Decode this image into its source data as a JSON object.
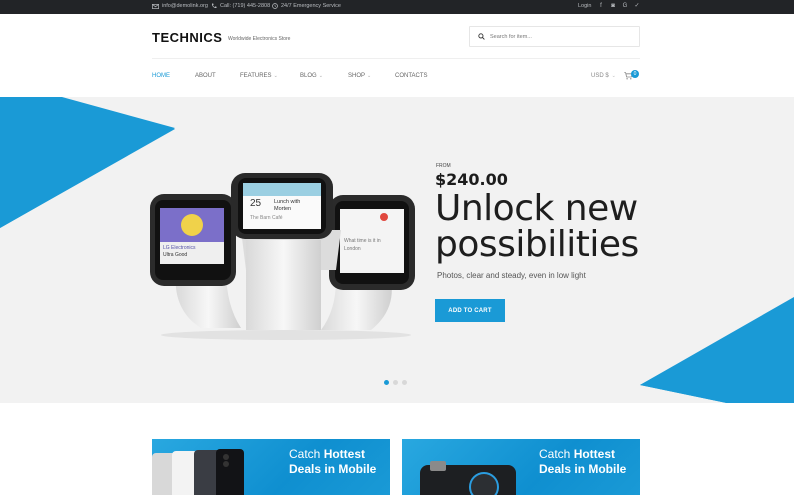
{
  "topbar": {
    "email": "info@demolink.org",
    "phone": "Call: (719) 445-2808",
    "service": "24/7 Emergency Service",
    "login": "Login",
    "social_icons": [
      "facebook-icon",
      "instagram-icon",
      "google-icon",
      "twitter-icon"
    ]
  },
  "header": {
    "logo": "TECHNICS",
    "tagline": "Worldwide Electronics Store",
    "search_placeholder": "Search for item..."
  },
  "nav": {
    "items": [
      {
        "label": "HOME",
        "active": true
      },
      {
        "label": "ABOUT"
      },
      {
        "label": "FEATURES",
        "dropdown": true
      },
      {
        "label": "BLOG",
        "dropdown": true
      },
      {
        "label": "SHOP",
        "dropdown": true
      },
      {
        "label": "CONTACTS"
      }
    ],
    "currency": "USD $",
    "cart_count": "0"
  },
  "hero": {
    "from": "FROM",
    "price": "$240.00",
    "headline_1": "Unlock new",
    "headline_2": "possibilities",
    "subline": "Photos, clear and steady, even in low light",
    "cta": "ADD TO CART",
    "watch_center": {
      "time": "25",
      "line1": "Lunch with",
      "line2": "Morten",
      "line3": "The Barn Café"
    },
    "watch_left": {
      "line1": "LG Electronics",
      "line2": "Ultra Good"
    },
    "watch_right": {
      "line1": "What time is it in",
      "line2": "London"
    },
    "slides": 3,
    "active_slide": 1
  },
  "promos": [
    {
      "line1_a": "Catch ",
      "line1_b": "Hottest",
      "line2": "Deals in Mobile"
    },
    {
      "line1_a": "Catch ",
      "line1_b": "Hottest",
      "line2": "Deals in Mobile"
    }
  ],
  "colors": {
    "accent": "#1a9ad6",
    "topbar": "#222427",
    "hero_bg": "#f2f2f2"
  }
}
